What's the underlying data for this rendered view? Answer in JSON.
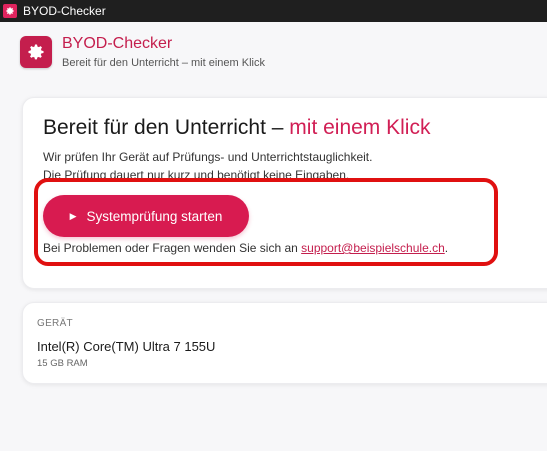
{
  "window": {
    "title": "BYOD-Checker"
  },
  "header": {
    "title": "BYOD-Checker",
    "subtitle": "Bereit für den Unterricht – mit einem Klick",
    "icon": "gear-icon"
  },
  "hero": {
    "headline_main": "Bereit für den Unterricht – ",
    "headline_accent": "mit einem Klick",
    "description_line1": "Wir prüfen Ihr Gerät auf Prüfungs- und Unterrichtstauglichkeit.",
    "description_line2": "Die Prüfung dauert nur kurz und benötigt keine Eingaben.",
    "start_button_label": "Systemprüfung starten",
    "help_text": "Bei Problemen oder Fragen wenden Sie sich an ",
    "support_email": "support@beispielschule.ch",
    "help_suffix": "."
  },
  "device": {
    "label": "GERÄT",
    "cpu": "Intel(R) Core(TM) Ultra 7 155U",
    "ram": "15 GB RAM"
  },
  "colors": {
    "accent": "#d11f55",
    "highlight": "#e01010",
    "titlebar": "#1f1f1f"
  }
}
